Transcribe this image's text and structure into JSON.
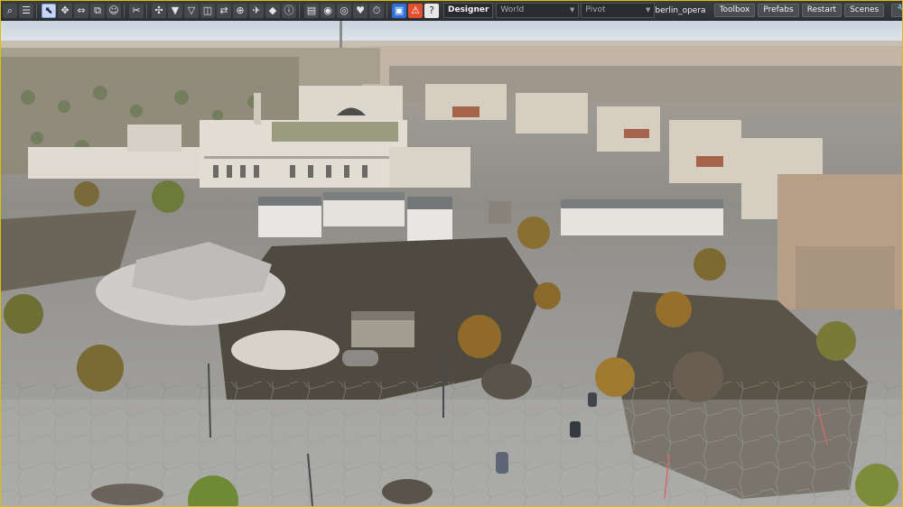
{
  "toolbar": {
    "tools": [
      {
        "name": "search-icon",
        "glyph": "⌕"
      },
      {
        "name": "menu-icon",
        "glyph": "☰"
      },
      {
        "name": "select-tool-icon",
        "glyph": "⬉",
        "selected": true
      },
      {
        "name": "move-tool-icon",
        "glyph": "✥"
      },
      {
        "name": "bounds-tool-icon",
        "glyph": "⇔"
      },
      {
        "name": "scale-tool-icon",
        "glyph": "⧉"
      },
      {
        "name": "emoji-tool-icon",
        "glyph": "☺"
      },
      {
        "name": "cut-icon",
        "glyph": "✂"
      },
      {
        "name": "transform-icon",
        "glyph": "✣"
      },
      {
        "name": "filter-down-icon",
        "glyph": "▼"
      },
      {
        "name": "filter-outline-icon",
        "glyph": "▽"
      },
      {
        "name": "split-view-icon",
        "glyph": "◫"
      },
      {
        "name": "swap-icon",
        "glyph": "⇄"
      },
      {
        "name": "target-icon",
        "glyph": "⊕"
      },
      {
        "name": "navigation-icon",
        "glyph": "✈"
      },
      {
        "name": "diamond-icon",
        "glyph": "◆"
      },
      {
        "name": "info-icon",
        "glyph": "ⓘ"
      },
      {
        "name": "document-icon",
        "glyph": "▤"
      },
      {
        "name": "eye-icon",
        "glyph": "◉"
      },
      {
        "name": "eye-alt-icon",
        "glyph": "◎"
      },
      {
        "name": "heart-icon",
        "glyph": "♥"
      },
      {
        "name": "timer-icon",
        "glyph": "⏱"
      },
      {
        "name": "save-icon",
        "glyph": "▣",
        "style": "blue"
      },
      {
        "name": "warning-icon",
        "glyph": "⚠",
        "style": "red"
      },
      {
        "name": "help-icon",
        "glyph": "?",
        "style": "white"
      }
    ],
    "mode_label": "Designer",
    "space_label": "World",
    "pivot_label": "Pivot",
    "scene_name": "berlin_opera",
    "buttons": {
      "toolbox": "Toolbox",
      "prefabs": "Prefabs",
      "restart": "Restart",
      "scenes": "Scenes"
    }
  },
  "colors": {
    "selection_border": "#d9c300",
    "toolbar_bg": "#34363a",
    "accent_blue": "#2f6fd8",
    "warning_red": "#e2502f"
  }
}
